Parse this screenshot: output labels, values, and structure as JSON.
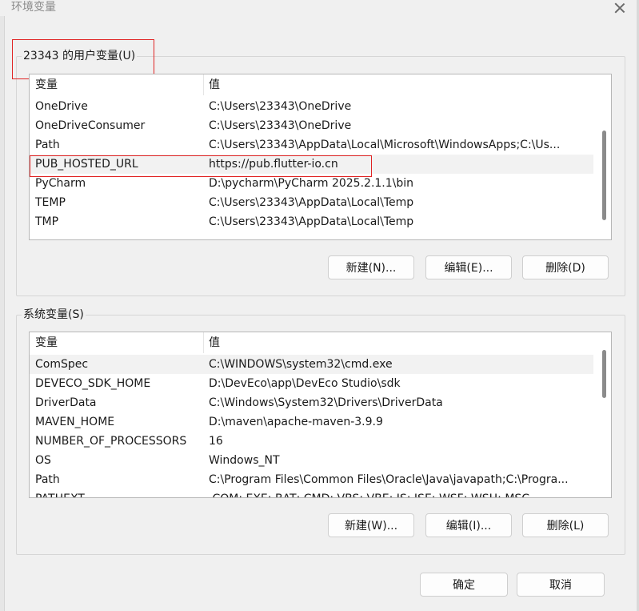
{
  "window": {
    "title": "环境变量"
  },
  "user_vars": {
    "group_label": "23343 的用户变量(U)",
    "columns": {
      "name": "变量",
      "value": "值"
    },
    "rows": [
      {
        "name": "OneDrive",
        "value": "C:\\Users\\23343\\OneDrive"
      },
      {
        "name": "OneDriveConsumer",
        "value": "C:\\Users\\23343\\OneDrive"
      },
      {
        "name": "Path",
        "value": "C:\\Users\\23343\\AppData\\Local\\Microsoft\\WindowsApps;C:\\Us..."
      },
      {
        "name": "PUB_HOSTED_URL",
        "value": "https://pub.flutter-io.cn"
      },
      {
        "name": "PyCharm",
        "value": "D:\\pycharm\\PyCharm 2025.2.1.1\\bin"
      },
      {
        "name": "TEMP",
        "value": "C:\\Users\\23343\\AppData\\Local\\Temp"
      },
      {
        "name": "TMP",
        "value": "C:\\Users\\23343\\AppData\\Local\\Temp"
      }
    ],
    "buttons": {
      "new": "新建(N)...",
      "edit": "编辑(E)...",
      "delete": "删除(D)"
    }
  },
  "system_vars": {
    "group_label": "系统变量(S)",
    "columns": {
      "name": "变量",
      "value": "值"
    },
    "rows": [
      {
        "name": "ComSpec",
        "value": "C:\\WINDOWS\\system32\\cmd.exe"
      },
      {
        "name": "DEVECO_SDK_HOME",
        "value": "D:\\DevEco\\app\\DevEco Studio\\sdk"
      },
      {
        "name": "DriverData",
        "value": "C:\\Windows\\System32\\Drivers\\DriverData"
      },
      {
        "name": "MAVEN_HOME",
        "value": "D:\\maven\\apache-maven-3.9.9"
      },
      {
        "name": "NUMBER_OF_PROCESSORS",
        "value": "16"
      },
      {
        "name": "OS",
        "value": "Windows_NT"
      },
      {
        "name": "Path",
        "value": "C:\\Program Files\\Common Files\\Oracle\\Java\\javapath;C:\\Progra..."
      },
      {
        "name": "PATHEXT",
        "value": ".COM;.EXE;.BAT;.CMD;.VBS;.VBE;.JS;.JSE;.WSF;.WSH;.MSC"
      }
    ],
    "buttons": {
      "new": "新建(W)...",
      "edit": "编辑(I)...",
      "delete": "删除(L)"
    }
  },
  "footer": {
    "ok": "确定",
    "cancel": "取消"
  },
  "icons": {
    "close": "close-icon"
  },
  "colors": {
    "highlight": "#e02424",
    "selected_row": "#f2f2f2"
  }
}
